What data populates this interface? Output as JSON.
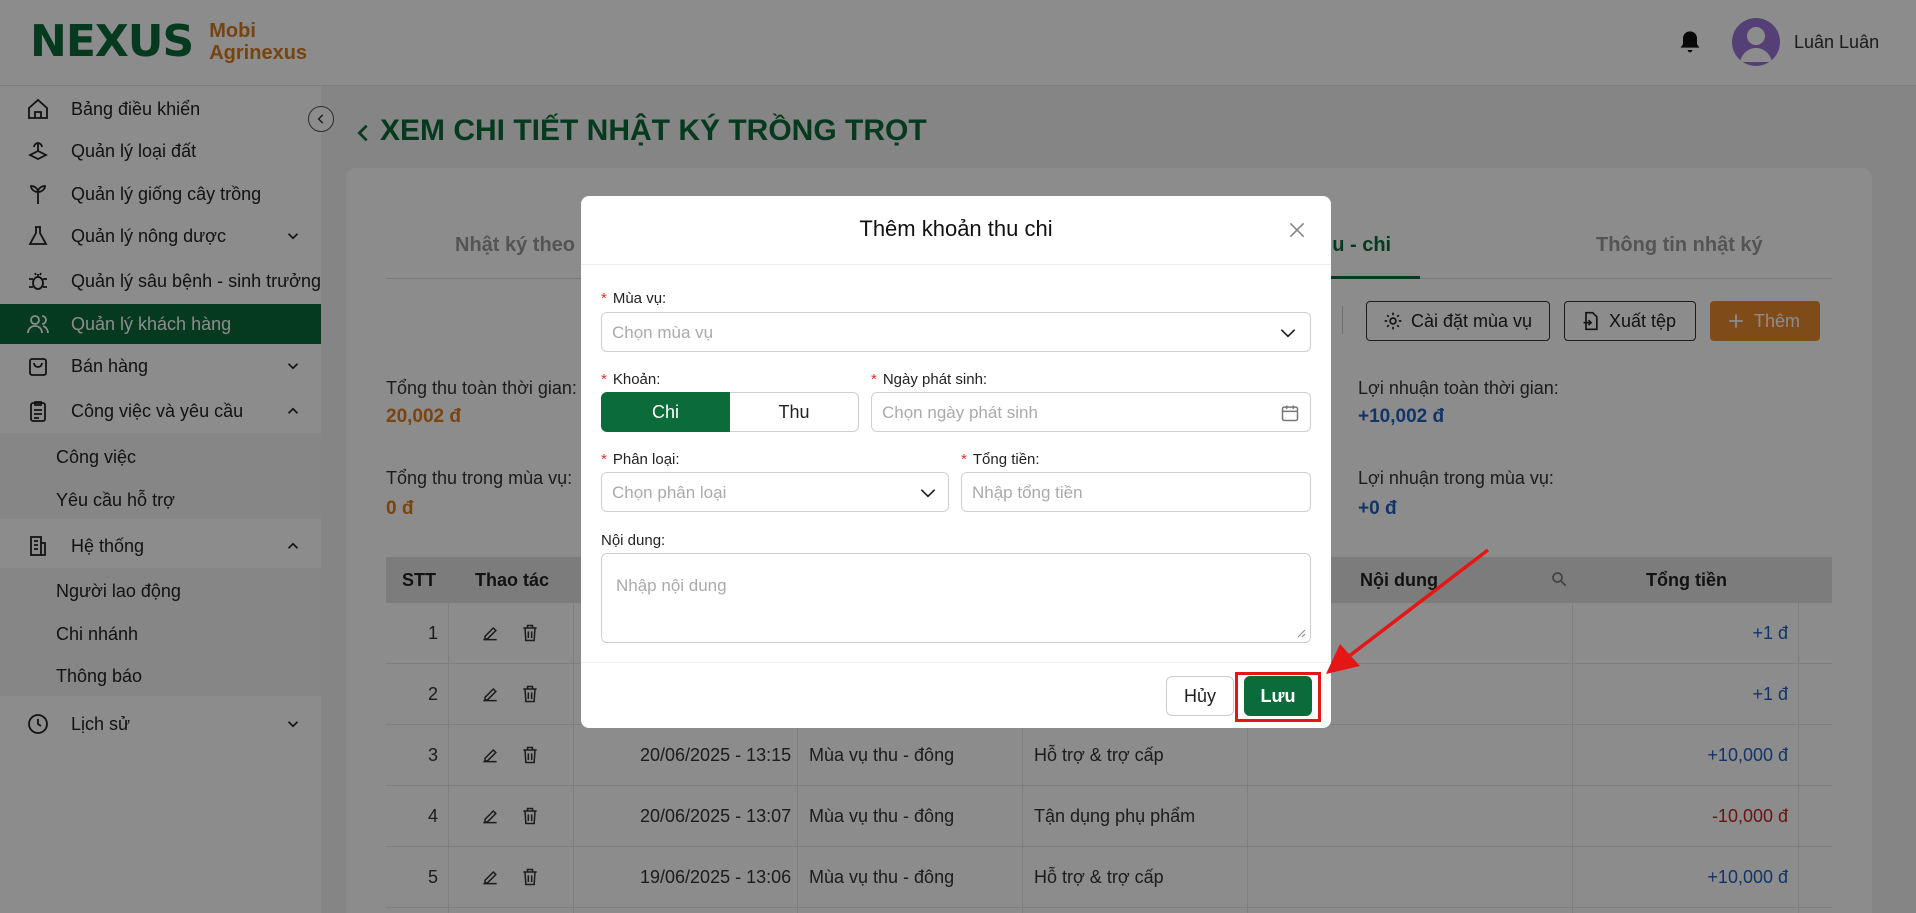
{
  "header": {
    "logo_mark": "NEXUS",
    "logo_line1": "Mobi",
    "logo_line2": "Agrinexus",
    "user_name": "Luân Luân",
    "bell_icon": "bell-icon",
    "avatar_icon": "user-avatar-icon"
  },
  "sidebar": {
    "items": [
      {
        "label": "Bảng điều khiển",
        "icon": "home-icon"
      },
      {
        "label": "Quản lý loại đất",
        "icon": "soil-icon"
      },
      {
        "label": "Quản lý giống cây trồng",
        "icon": "plant-icon"
      },
      {
        "label": "Quản lý nông dược",
        "icon": "flask-icon"
      },
      {
        "label": "Quản lý sâu bệnh - sinh trưởng",
        "icon": "bug-icon"
      },
      {
        "label": "Quản lý khách hàng",
        "icon": "users-icon"
      },
      {
        "label": "Bán hàng",
        "icon": "shopping-bag-icon"
      },
      {
        "label": "Công việc và yêu cầu",
        "icon": "clipboard-icon"
      },
      {
        "label": "Hệ thống",
        "icon": "building-icon"
      },
      {
        "label": "Lịch sử",
        "icon": "history-icon"
      }
    ],
    "work_sub": [
      "Công việc",
      "Yêu cầu hỗ trợ"
    ],
    "system_sub": [
      "Người lao động",
      "Chi nhánh",
      "Thông báo"
    ],
    "active": "Quản lý khách hàng"
  },
  "main": {
    "title": "XEM CHI TIẾT NHẬT KÝ TRỒNG TRỌT",
    "tabs": [
      "Nhật ký theo",
      "hu - chi",
      "Thông tin nhật ký"
    ],
    "buttons": {
      "season_settings": "Cài đặt mùa vụ",
      "export": "Xuất tệp",
      "add": "Thêm"
    },
    "stats": {
      "total_income_all_label": "Tổng thu toàn thời gian:",
      "total_income_all_value": "20,002 đ",
      "total_income_season_label": "Tổng thu trong mùa vụ:",
      "total_income_season_value": "0 đ",
      "profit_all_label": "Lợi nhuận toàn thời gian:",
      "profit_all_value": "+10,002 đ",
      "profit_season_label": "Lợi nhuận trong mùa vụ:",
      "profit_season_value": "+0 đ"
    },
    "table": {
      "headers": {
        "stt": "STT",
        "actions": "Thao tác",
        "content": "Nội dung",
        "total": "Tổng tiền"
      },
      "rows": [
        {
          "stt": "1",
          "date": "",
          "season": "",
          "category": "",
          "amount": "+1 đ",
          "type": "pos"
        },
        {
          "stt": "2",
          "date": "",
          "season": "",
          "category": "",
          "amount": "+1 đ",
          "type": "pos"
        },
        {
          "stt": "3",
          "date": "20/06/2025 - 13:15",
          "season": "Mùa vụ thu - đông",
          "category": "Hỗ trợ & trợ cấp",
          "amount": "+10,000 đ",
          "type": "pos"
        },
        {
          "stt": "4",
          "date": "20/06/2025 - 13:07",
          "season": "Mùa vụ thu - đông",
          "category": "Tận dụng phụ phẩm",
          "amount": "-10,000 đ",
          "type": "neg"
        },
        {
          "stt": "5",
          "date": "19/06/2025 - 13:06",
          "season": "Mùa vụ thu - đông",
          "category": "Hỗ trợ & trợ cấp",
          "amount": "+10,000 đ",
          "type": "pos"
        }
      ]
    }
  },
  "modal": {
    "title": "Thêm khoản thu chi",
    "season_label": "Mùa vụ:",
    "season_placeholder": "Chọn mùa vụ",
    "type_label": "Khoản:",
    "type_options": [
      "Chi",
      "Thu"
    ],
    "type_selected": "Chi",
    "date_label": "Ngày phát sinh:",
    "date_placeholder": "Chọn ngày phát sinh",
    "category_label": "Phân loại:",
    "category_placeholder": "Chọn phân loại",
    "total_label": "Tổng tiền:",
    "total_placeholder": "Nhập tổng tiền",
    "content_label": "Nội dung:",
    "content_placeholder": "Nhập nội dung",
    "cancel": "Hủy",
    "save": "Lưu"
  },
  "colors": {
    "brand_green": "#0b6b3a",
    "accent_orange": "#e88a2e",
    "highlight_red": "#e41616"
  }
}
